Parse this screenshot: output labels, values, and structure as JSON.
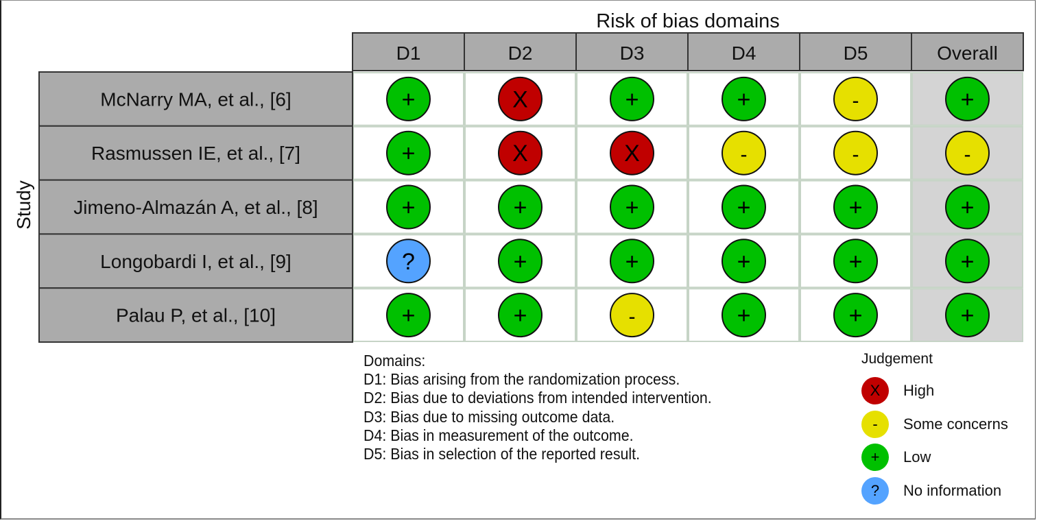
{
  "chart_data": {
    "type": "table",
    "title": "Risk of bias domains",
    "ylabel": "Study",
    "columns": [
      "D1",
      "D2",
      "D3",
      "D4",
      "D5",
      "Overall"
    ],
    "rows": [
      {
        "study": "McNarry MA, et al., [6]",
        "judgements": [
          "Low",
          "High",
          "Low",
          "Low",
          "Some concerns",
          "Low"
        ]
      },
      {
        "study": "Rasmussen IE, et al., [7]",
        "judgements": [
          "Low",
          "High",
          "High",
          "Some concerns",
          "Some concerns",
          "Some concerns"
        ]
      },
      {
        "study": "Jimeno-Almazán A, et al., [8]",
        "judgements": [
          "Low",
          "Low",
          "Low",
          "Low",
          "Low",
          "Low"
        ]
      },
      {
        "study": "Longobardi I, et al., [9]",
        "judgements": [
          "No information",
          "Low",
          "Low",
          "Low",
          "Low",
          "Low"
        ]
      },
      {
        "study": "Palau P, et al., [10]",
        "judgements": [
          "Low",
          "Low",
          "Some concerns",
          "Low",
          "Low",
          "Low"
        ]
      }
    ],
    "judgement_styles": {
      "High": {
        "symbol": "X",
        "color": "#C00000"
      },
      "Some concerns": {
        "symbol": "-",
        "color": "#E6E000"
      },
      "Low": {
        "symbol": "+",
        "color": "#00C000"
      },
      "No information": {
        "symbol": "?",
        "color": "#54A3FF"
      }
    },
    "domains_legend": {
      "title": "Domains:",
      "items": [
        "D1: Bias arising from the randomization process.",
        "D2: Bias due to deviations from intended intervention.",
        "D3: Bias due to missing outcome data.",
        "D4: Bias in measurement of the outcome.",
        "D5: Bias in selection of the reported result."
      ]
    },
    "judgement_legend": {
      "title": "Judgement",
      "items": [
        {
          "label": "High",
          "symbol": "X",
          "color": "#C00000"
        },
        {
          "label": "Some concerns",
          "symbol": "-",
          "color": "#E6E000"
        },
        {
          "label": "Low",
          "symbol": "+",
          "color": "#00C000"
        },
        {
          "label": "No information",
          "symbol": "?",
          "color": "#54A3FF"
        }
      ]
    }
  },
  "colors": {
    "header_fill": "#ABABAB",
    "overall_fill": "#D4D4D4",
    "cell_fill": "#FFFFFF"
  }
}
